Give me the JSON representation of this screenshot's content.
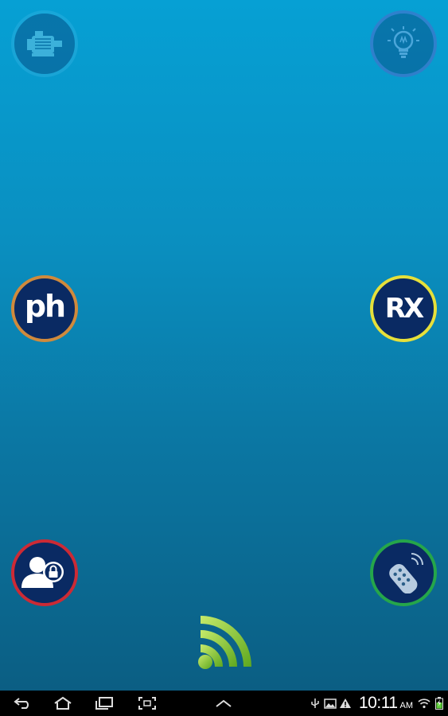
{
  "home": {
    "buttons": [
      {
        "name": "motor",
        "icon": "electric-motor-icon",
        "ring_color": "#3bb6e6",
        "enabled": false
      },
      {
        "name": "light",
        "icon": "light-bulb-icon",
        "ring_color": "#7a4cc4",
        "enabled": false
      },
      {
        "name": "ph",
        "label": "ph",
        "ring_color": "#d08a3c",
        "enabled": true
      },
      {
        "name": "rx",
        "label": "RX",
        "ring_color": "#e6e03a",
        "enabled": true
      },
      {
        "name": "user-lock",
        "icon": "user-lock-icon",
        "ring_color": "#cc2a35",
        "enabled": true
      },
      {
        "name": "remote",
        "icon": "remote-control-icon",
        "ring_color": "#25a64a",
        "enabled": true
      }
    ],
    "bottom_logo": "wifi-signal-icon"
  },
  "navbar": {
    "icons": [
      "back-icon",
      "home-icon",
      "recent-apps-icon",
      "screenshot-icon",
      "up-chevron-icon"
    ],
    "status_icons": [
      "usb-icon",
      "image-icon",
      "warning-icon",
      "wifi-icon",
      "battery-charging-icon"
    ],
    "time": "10:11",
    "ampm": "AM"
  },
  "colors": {
    "background_top": "#06a0d4",
    "background_bottom": "#0b5e83",
    "button_fill": "#0a2a63",
    "logo_green": "#8cc83a"
  }
}
